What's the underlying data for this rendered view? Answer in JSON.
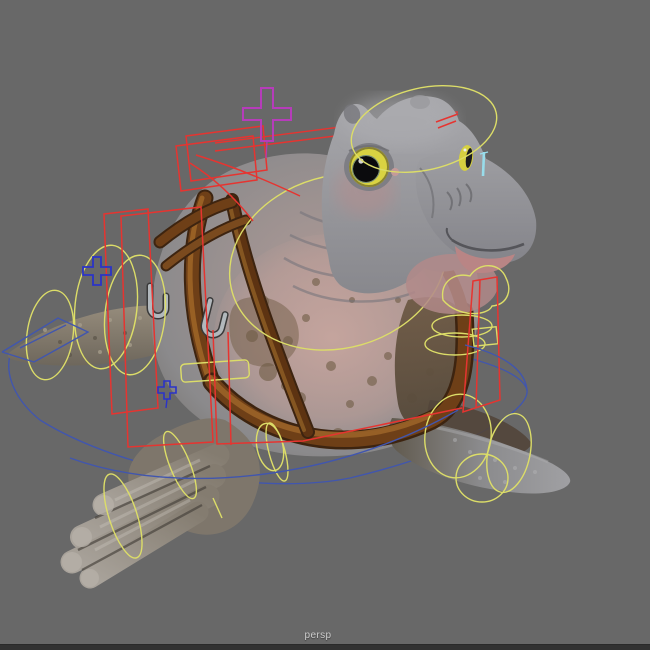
{
  "viewport": {
    "camera_label": "persp",
    "background_color": "#686868",
    "bottom_bar_color": "#323232"
  },
  "colors": {
    "control_yellow": "#dcdd68",
    "control_red": "#e63430",
    "control_blue": "#4156ae",
    "control_dark_blue": "#2a33c8",
    "control_magenta": "#b63cba",
    "control_cyan": "#98dcea",
    "harness_brown": "#774820",
    "body_gray": "#95959a",
    "belly_pink": "#bfa09a",
    "eye_yellow": "#d9d342"
  },
  "rig": {
    "subject": "seal-hippo character mesh with leather harness",
    "controls": [
      {
        "name": "head-rotation-ring",
        "color": "yellow"
      },
      {
        "name": "neck-chest-ring",
        "color": "yellow"
      },
      {
        "name": "shoulder-rings",
        "color": "yellow"
      },
      {
        "name": "tail-rings",
        "color": "yellow"
      },
      {
        "name": "flipper-rings",
        "color": "yellow"
      },
      {
        "name": "jaw-blob-controls",
        "color": "yellow"
      },
      {
        "name": "spine-box-controls",
        "color": "red"
      },
      {
        "name": "hip-box-control",
        "color": "red"
      },
      {
        "name": "right-arm-box-control",
        "color": "red"
      },
      {
        "name": "root-global-ellipse",
        "color": "blue"
      },
      {
        "name": "tail-wire-control",
        "color": "blue"
      },
      {
        "name": "translate-plus-manipulator",
        "color": "magenta"
      },
      {
        "name": "shoulder-plus-manipulator",
        "color": "dark_blue"
      },
      {
        "name": "hip-plus-manipulator",
        "color": "dark_blue"
      },
      {
        "name": "eye-aim-marker",
        "color": "cyan"
      }
    ]
  }
}
